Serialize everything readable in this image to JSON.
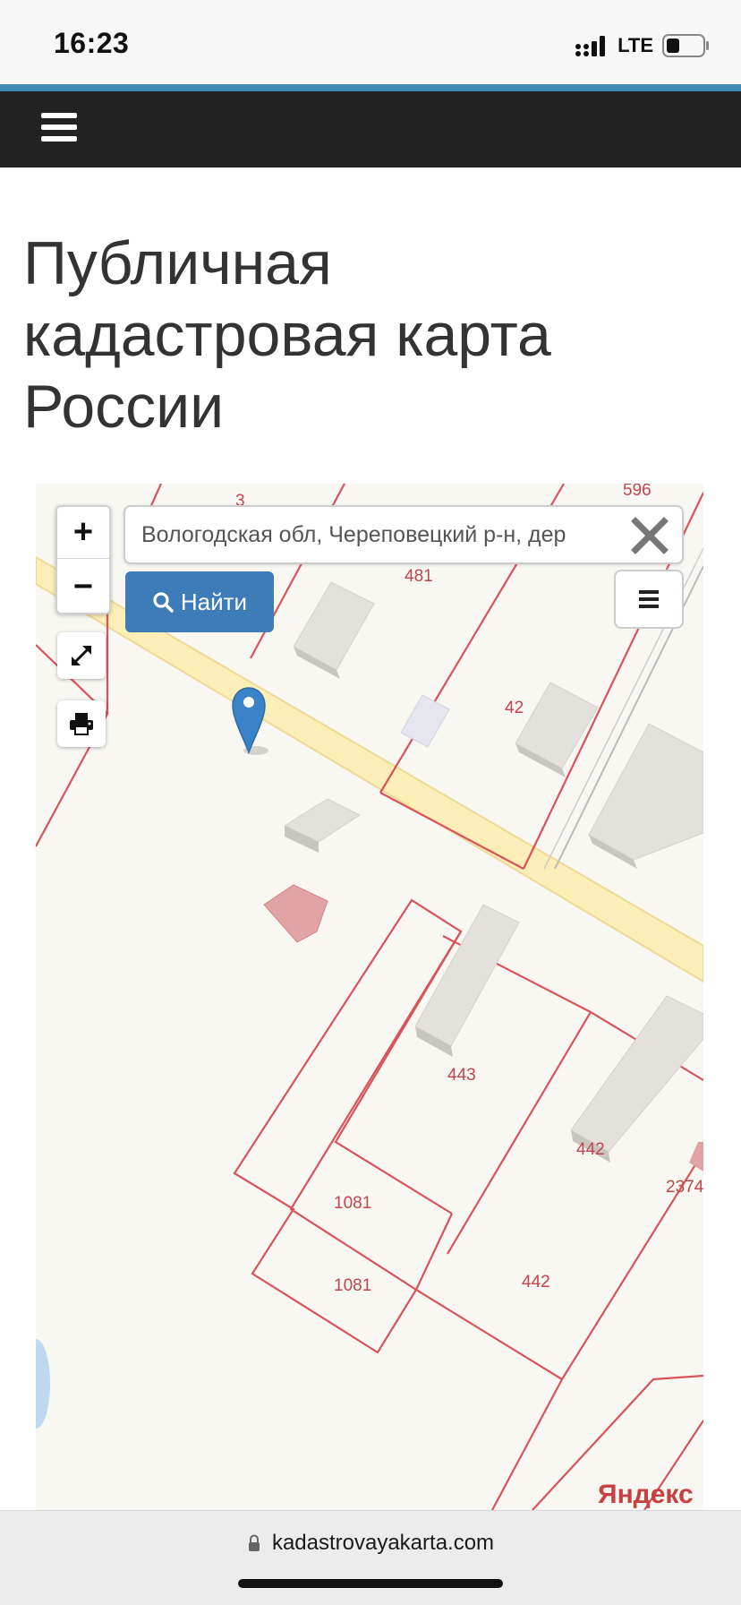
{
  "status_bar": {
    "time": "16:23",
    "network": "LTE"
  },
  "page": {
    "title": "Публичная кадастровая карта России"
  },
  "map": {
    "search": {
      "value": "Вологодская обл, Череповецкий р-н, дер"
    },
    "find_button_label": "Найти",
    "zoom_in_label": "+",
    "zoom_out_label": "−",
    "parcel_labels": [
      "596",
      "3",
      "481",
      "42",
      "443",
      "442",
      "2374",
      "1081",
      "1081",
      "442"
    ],
    "attribution": "Яндекс"
  },
  "browser": {
    "url": "kadastrovayakarta.com"
  },
  "colors": {
    "navbar": "#222222",
    "accent_stripe": "#3f88b6",
    "button": "#3d7cb8",
    "parcel_line": "#d9535a",
    "road": "#fbeeb6"
  }
}
